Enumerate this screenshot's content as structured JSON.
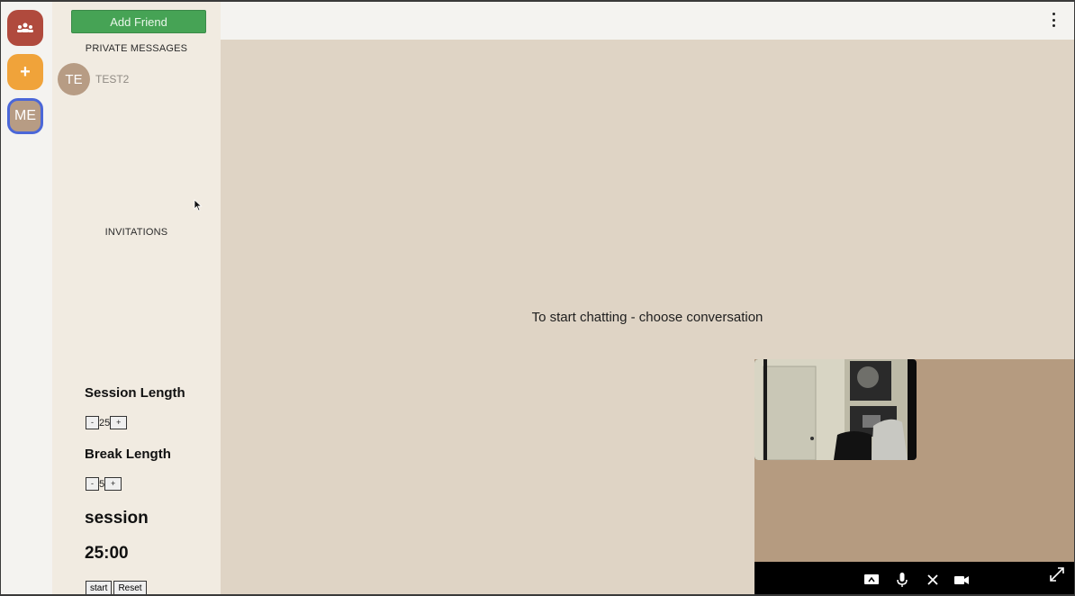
{
  "rail": {
    "me_label": "ME",
    "add_label": "+"
  },
  "side": {
    "add_friend_label": "Add Friend",
    "private_messages_title": "PRIVATE MESSAGES",
    "contacts": [
      {
        "initials": "TE",
        "name": "TEST2"
      }
    ],
    "invitations_title": "INVITATIONS"
  },
  "timer": {
    "session_length_label": "Session Length",
    "session_length_value": "25",
    "break_length_label": "Break Length",
    "break_length_value": "5",
    "minus_label": "-",
    "plus_label": "+",
    "current_mode": "session",
    "time_left": "25:00",
    "start_label": "start",
    "reset_label": "Reset"
  },
  "main": {
    "empty_message": "To start chatting - choose conversation"
  },
  "colors": {
    "group_server": "#b04a3d",
    "add_server": "#f0a33a",
    "avatar": "#b79c84",
    "add_friend": "#46a355",
    "chat_bg": "#dfd4c5",
    "video_bg": "#b59b80"
  }
}
